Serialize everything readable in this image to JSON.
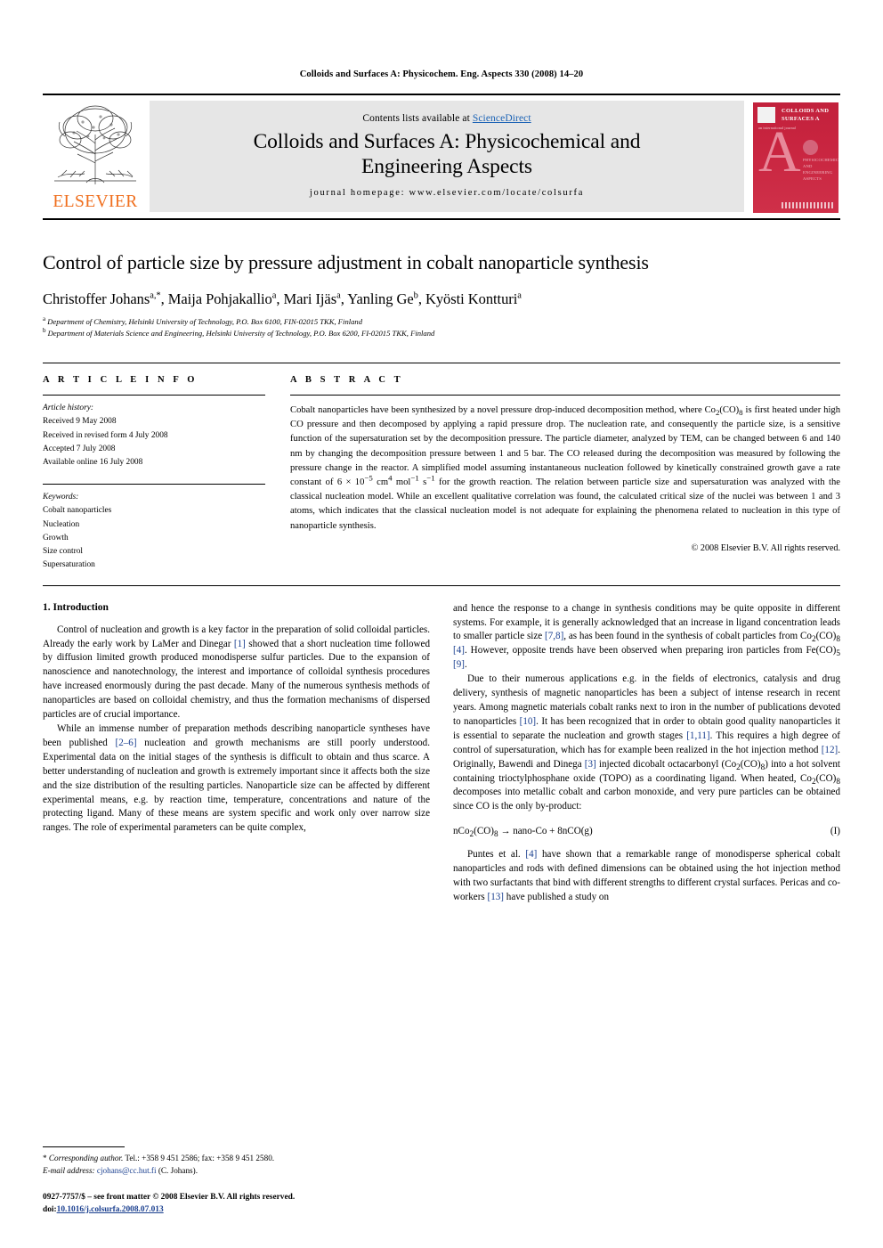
{
  "running_head": "Colloids and Surfaces A: Physicochem. Eng. Aspects 330 (2008) 14–20",
  "masthead": {
    "publisher": "ELSEVIER",
    "contents_prefix": "Contents lists available at ",
    "contents_link": "ScienceDirect",
    "journal_title_line1": "Colloids and Surfaces A: Physicochemical and",
    "journal_title_line2": "Engineering Aspects",
    "homepage": "journal homepage: www.elsevier.com/locate/colsurfa",
    "cover": {
      "title": "COLLOIDS AND SURFACES A",
      "letter": "A",
      "subtitle": "PHYSICOCHEMICAL AND ENGINEERING ASPECTS",
      "tiny": "an international journal",
      "accent_color": "#c2213c"
    }
  },
  "article": {
    "title": "Control of particle size by pressure adjustment in cobalt nanoparticle synthesis",
    "authors_html": "Christoffer Johans<sup>a,*</sup>, Maija Pohjakallio<sup>a</sup>, Mari Ijäs<sup>a</sup>, Yanling Ge<sup>b</sup>, Kyösti Kontturi<sup>a</sup>",
    "affiliation_a": "Department of Chemistry, Helsinki University of Technology, P.O. Box 6100, FIN-02015 TKK, Finland",
    "affiliation_b": "Department of Materials Science and Engineering, Helsinki University of Technology, P.O. Box 6200, FI-02015 TKK, Finland"
  },
  "info": {
    "heading": "A R T I C L E    I N F O",
    "history_label": "Article history:",
    "history": [
      "Received 9 May 2008",
      "Received in revised form 4 July 2008",
      "Accepted 7 July 2008",
      "Available online 16 July 2008"
    ],
    "keywords_label": "Keywords:",
    "keywords": [
      "Cobalt nanoparticles",
      "Nucleation",
      "Growth",
      "Size control",
      "Supersaturation"
    ]
  },
  "abstract": {
    "heading": "A B S T R A C T",
    "text_html": "Cobalt nanoparticles have been synthesized by a novel pressure drop-induced decomposition method, where Co<sub>2</sub>(CO)<sub>8</sub> is first heated under high CO pressure and then decomposed by applying a rapid pressure drop. The nucleation rate, and consequently the particle size, is a sensitive function of the supersaturation set by the decomposition pressure. The particle diameter, analyzed by TEM, can be changed between 6 and 140 nm by changing the decomposition pressure between 1 and 5 bar. The CO released during the decomposition was measured by following the pressure change in the reactor. A simplified model assuming instantaneous nucleation followed by kinetically constrained growth gave a rate constant of 6 &times; 10<sup>&minus;5</sup> cm<sup>4</sup> mol<sup>&minus;1</sup> s<sup>&minus;1</sup> for the growth reaction. The relation between particle size and supersaturation was analyzed with the classical nucleation model. While an excellent qualitative correlation was found, the calculated critical size of the nuclei was between 1 and 3 atoms, which indicates that the classical nucleation model is not adequate for explaining the phenomena related to nucleation in this type of nanoparticle synthesis.",
    "copyright": "© 2008 Elsevier B.V. All rights reserved."
  },
  "body": {
    "section_number_title": "1.  Introduction",
    "left_paragraphs_html": [
      "Control of nucleation and growth is a key factor in the preparation of solid colloidal particles. Already the early work by LaMer and Dinegar <span class=\"ref\">[1]</span> showed that a short nucleation time followed by diffusion limited growth produced monodisperse sulfur particles. Due to the expansion of nanoscience and nanotechnology, the interest and importance of colloidal synthesis procedures have increased enormously during the past decade. Many of the numerous synthesis methods of nanoparticles are based on colloidal chemistry, and thus the formation mechanisms of dispersed particles are of crucial importance.",
      "While an immense number of preparation methods describing nanoparticle syntheses have been published <span class=\"ref\">[2–6]</span> nucleation and growth mechanisms are still poorly understood. Experimental data on the initial stages of the synthesis is difficult to obtain and thus scarce. A better understanding of nucleation and growth is extremely important since it affects both the size and the size distribution of the resulting particles. Nanoparticle size can be affected by different experimental means, e.g. by reaction time, temperature, concentrations and nature of the protecting ligand. Many of these means are system specific and work only over narrow size ranges. The role of experimental parameters can be quite complex,"
    ],
    "right_paragraphs_html": [
      "and hence the response to a change in synthesis conditions may be quite opposite in different systems. For example, it is generally acknowledged that an increase in ligand concentration leads to smaller particle size <span class=\"ref\">[7,8]</span>, as has been found in the synthesis of cobalt particles from Co<sub>2</sub>(CO)<sub>8</sub> <span class=\"ref\">[4]</span>. However, opposite trends have been observed when preparing iron particles from Fe(CO)<sub>5</sub> <span class=\"ref\">[9]</span>.",
      "Due to their numerous applications e.g. in the fields of electronics, catalysis and drug delivery, synthesis of magnetic nanoparticles has been a subject of intense research in recent years. Among magnetic materials cobalt ranks next to iron in the number of publications devoted to nanoparticles <span class=\"ref\">[10]</span>. It has been recognized that in order to obtain good quality nanoparticles it is essential to separate the nucleation and growth stages <span class=\"ref\">[1,11]</span>. This requires a high degree of control of supersaturation, which has for example been realized in the hot injection method <span class=\"ref\">[12]</span>. Originally, Bawendi and Dinega <span class=\"ref\">[3]</span> injected dicobalt octacarbonyl (Co<sub>2</sub>(CO)<sub>8</sub>) into a hot solvent containing trioctylphosphane oxide (TOPO) as a coordinating ligand. When heated, Co<sub>2</sub>(CO)<sub>8</sub> decomposes into metallic cobalt and carbon monoxide, and very pure particles can be obtained since CO is the only by-product:"
    ],
    "equation_html": "nCo<sub>2</sub>(CO)<sub>8</sub> →  nano-Co + 8nCO(g)",
    "equation_number": "(I)",
    "right_paragraph_after_eq_html": "Puntes et al. <span class=\"ref\">[4]</span> have shown that a remarkable range of monodisperse spherical cobalt nanoparticles and rods with defined dimensions can be obtained using the hot injection method with two surfactants that bind with different strengths to different crystal surfaces. Pericas and co-workers <span class=\"ref\">[13]</span> have published a study on"
  },
  "footnote": {
    "corresponding_html": "*   <span class=\"ital\">Corresponding author.</span> Tel.: +358 9 451 2586; fax: +358 9 451 2580.",
    "email_html": "<span class=\"ital\">E-mail address:</span> <span class=\"fn-mail\">cjohans@cc.hut.fi</span> (C. Johans).",
    "imprint_line1": "0927-7757/$ – see front matter © 2008 Elsevier B.V. All rights reserved.",
    "imprint_doi_prefix": "doi:",
    "imprint_doi": "10.1016/j.colsurfa.2008.07.013"
  }
}
